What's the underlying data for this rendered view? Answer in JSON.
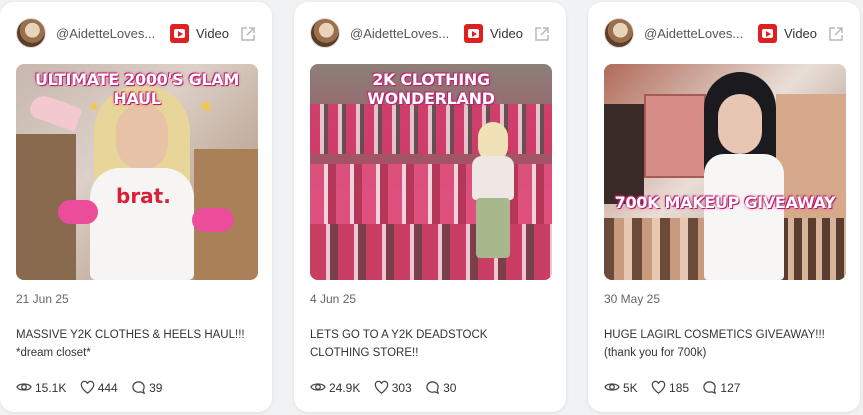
{
  "cards": [
    {
      "handle": "@AidetteLoves...",
      "type_label": "Video",
      "overlay_text": "ULTIMATE 2000'S GLAM HAUL",
      "shirt_text": "brat.",
      "date": "21 Jun 25",
      "title": "MASSIVE Y2K CLOTHES & HEELS HAUL!!! *dream closet*",
      "views": "15.1K",
      "likes": "444",
      "comments": "39"
    },
    {
      "handle": "@AidetteLoves...",
      "type_label": "Video",
      "overlay_text": "2K CLOTHING WONDERLAND",
      "date": "4 Jun 25",
      "title": "LETS GO TO A Y2K DEADSTOCK CLOTHING STORE!!",
      "views": "24.9K",
      "likes": "303",
      "comments": "30"
    },
    {
      "handle": "@AidetteLoves...",
      "type_label": "Video",
      "overlay_text": "700K MAKEUP GIVEAWAY",
      "date": "30 May 25",
      "title": "HUGE LAGIRL COSMETICS GIVEAWAY!!! (thank you for 700k)",
      "views": "5K",
      "likes": "185",
      "comments": "127"
    }
  ],
  "icons": {
    "platform": "youtube-icon",
    "external": "external-link-icon",
    "views": "eye-icon",
    "likes": "heart-icon",
    "comments": "comment-icon"
  },
  "colors": {
    "youtube_red": "#e02020",
    "card_bg": "#ffffff",
    "page_bg": "#f1f2f4",
    "overlay_pink": "#c9267a"
  }
}
